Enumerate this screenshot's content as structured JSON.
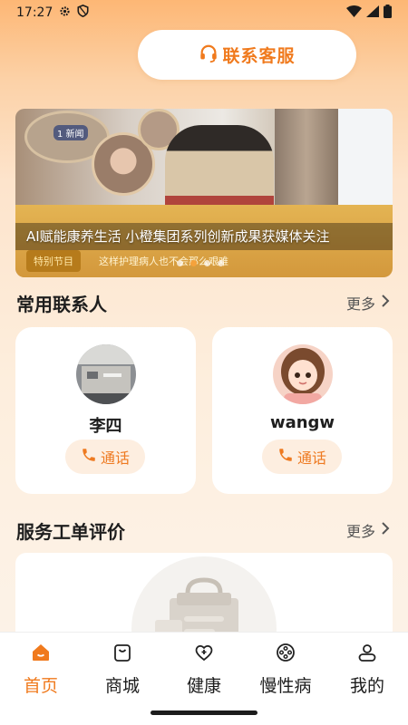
{
  "status": {
    "time": "17:27"
  },
  "service": {
    "label": "联系客服",
    "icon": "headset-icon"
  },
  "banner": {
    "caption": "AI赋能康养生活 小橙集团系列创新成果获媒体关注",
    "badge_text": "特别节目",
    "subtitle_text": "这样护理病人也不会那么艰难",
    "photo_tag": "1 新闻",
    "page_count": 4,
    "active_page": 1
  },
  "contacts_section": {
    "title": "常用联系人",
    "more": "更多",
    "items": [
      {
        "name": "李四",
        "call_label": "通话"
      },
      {
        "name": "wangw",
        "call_label": "通话"
      }
    ]
  },
  "reviews_section": {
    "title": "服务工单评价",
    "more": "更多"
  },
  "tabbar": {
    "items": [
      {
        "label": "首页",
        "icon": "home-icon",
        "active": true
      },
      {
        "label": "商城",
        "icon": "shopping-bag-icon",
        "active": false
      },
      {
        "label": "健康",
        "icon": "heart-plus-icon",
        "active": false
      },
      {
        "label": "慢性病",
        "icon": "pill-disc-icon",
        "active": false
      },
      {
        "label": "我的",
        "icon": "user-icon",
        "active": false
      }
    ]
  },
  "colors": {
    "accent": "#f07a1d",
    "call_bg": "#fdeee0"
  }
}
